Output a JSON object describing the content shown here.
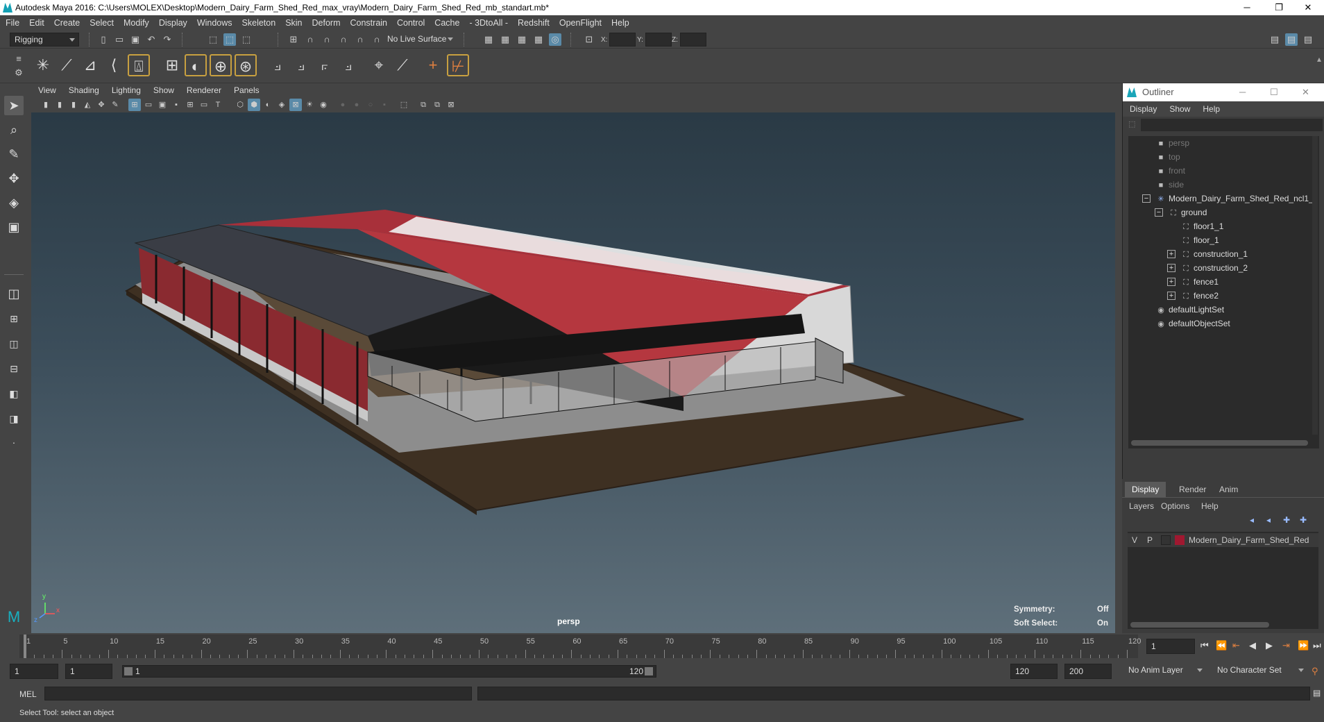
{
  "window": {
    "title": "Autodesk Maya 2016: C:\\Users\\MOLEX\\Desktop\\Modern_Dairy_Farm_Shed_Red_max_vray\\Modern_Dairy_Farm_Shed_Red_mb_standart.mb*",
    "minimize": "─",
    "maximize": "❐",
    "close": "✕"
  },
  "menubar": [
    "File",
    "Edit",
    "Create",
    "Select",
    "Modify",
    "Display",
    "Windows",
    "Skeleton",
    "Skin",
    "Deform",
    "Constrain",
    "Control",
    "Cache",
    "- 3DtoAll -",
    "Redshift",
    "OpenFlight",
    "Help"
  ],
  "statusline": {
    "menuset": "Rigging",
    "live_surface": "No Live Surface",
    "x_label": "X:",
    "y_label": "Y:",
    "z_label": "Z:"
  },
  "panel": {
    "menus": [
      "View",
      "Shading",
      "Lighting",
      "Show",
      "Renderer",
      "Panels"
    ],
    "camera": "persp",
    "symmetry_label": "Symmetry:",
    "symmetry_value": "Off",
    "softselect_label": "Soft Select:",
    "softselect_value": "On",
    "axis_y": "y",
    "axis_x": "x",
    "axis_z": "z"
  },
  "outliner": {
    "title": "Outliner",
    "menus": [
      "Display",
      "Show",
      "Help"
    ],
    "items": [
      {
        "label": "persp",
        "dim": true
      },
      {
        "label": "top",
        "dim": true
      },
      {
        "label": "front",
        "dim": true
      },
      {
        "label": "side",
        "dim": true
      },
      {
        "label": "Modern_Dairy_Farm_Shed_Red_ncl1_1"
      },
      {
        "label": "ground"
      },
      {
        "label": "floor1_1"
      },
      {
        "label": "floor_1"
      },
      {
        "label": "construction_1"
      },
      {
        "label": "construction_2"
      },
      {
        "label": "fence1"
      },
      {
        "label": "fence2"
      },
      {
        "label": "defaultLightSet"
      },
      {
        "label": "defaultObjectSet"
      }
    ]
  },
  "layer_editor": {
    "tabs": [
      "Display",
      "Render",
      "Anim"
    ],
    "menus": [
      "Layers",
      "Options",
      "Help"
    ],
    "layer": {
      "v": "V",
      "p": "P",
      "name": "Modern_Dairy_Farm_Shed_Red",
      "color": "#a01830"
    }
  },
  "timeline": {
    "ticks": [
      "1",
      "5",
      "10",
      "15",
      "20",
      "25",
      "30",
      "35",
      "40",
      "45",
      "50",
      "55",
      "60",
      "65",
      "70",
      "75",
      "80",
      "85",
      "90",
      "95",
      "100",
      "105",
      "110",
      "115",
      "120"
    ],
    "current_frame": "1"
  },
  "range": {
    "start": "1",
    "start2": "1",
    "slider_start": "1",
    "slider_end": "120",
    "end": "120",
    "end2": "200",
    "anim_layer": "No Anim Layer",
    "char_set": "No Character Set"
  },
  "mel": {
    "label": "MEL"
  },
  "helpline": "Select Tool: select an object",
  "colors": {
    "accent": "#5a8aa8",
    "roof": "#a8303a",
    "ground": "#4a3a2a"
  }
}
